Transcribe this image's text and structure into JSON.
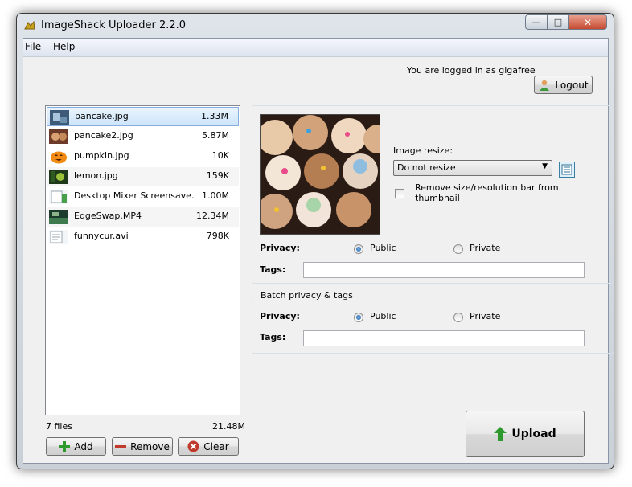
{
  "window": {
    "title": "ImageShack Uploader 2.2.0"
  },
  "menu": {
    "file": "File",
    "help": "Help"
  },
  "login": {
    "text": "You are logged in as gigafree",
    "logout_label": "Logout"
  },
  "files": [
    {
      "name": "pancake.jpg",
      "size": "1.33M",
      "thumb": "photo-thumbnail"
    },
    {
      "name": "pancake2.jpg",
      "size": "5.87M",
      "thumb": "photo-thumbnail"
    },
    {
      "name": "pumpkin.jpg",
      "size": "10K",
      "thumb": "pumpkin-thumbnail"
    },
    {
      "name": "lemon.jpg",
      "size": "159K",
      "thumb": "photo-thumbnail"
    },
    {
      "name": "Desktop Mixer Screensave…",
      "size": "1.00M",
      "thumb": "document-thumbnail"
    },
    {
      "name": "EdgeSwap.MP4",
      "size": "12.34M",
      "thumb": "video-thumbnail"
    },
    {
      "name": "funnycur.avi",
      "size": "798K",
      "thumb": "document-thumbnail"
    }
  ],
  "summary": {
    "count": "7 files",
    "total": "21.48M"
  },
  "actions": {
    "add": "Add",
    "remove": "Remove",
    "clear": "Clear",
    "upload": "Upload"
  },
  "image_options": {
    "resize_label": "Image resize:",
    "resize_value": "Do not resize",
    "remove_bar_label": "Remove size/resolution bar from thumbnail",
    "remove_bar_checked": false
  },
  "privacy": {
    "label": "Privacy:",
    "public": "Public",
    "private": "Private",
    "selected": "Public"
  },
  "tags": {
    "label": "Tags:",
    "value": ""
  },
  "batch": {
    "title": "Batch privacy & tags",
    "privacy_label": "Privacy:",
    "public": "Public",
    "private": "Private",
    "selected": "Public",
    "tags_label": "Tags:",
    "tags_value": ""
  },
  "colors": {
    "add_icon": "#2e9a2e",
    "remove_icon": "#c0392b",
    "clear_icon": "#c0392b",
    "upload_icon": "#2e9a2e",
    "selection": "#cde5fb"
  }
}
